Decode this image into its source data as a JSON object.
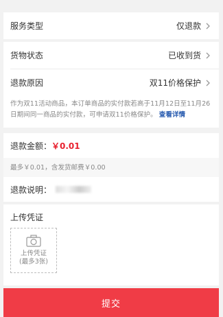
{
  "service": {
    "label": "服务类型",
    "value": "仅退款"
  },
  "goods": {
    "label": "货物状态",
    "value": "已收到货"
  },
  "reason": {
    "label": "退款原因",
    "value": "双11价格保护"
  },
  "note": {
    "text": "作为双11活动商品，本订单商品的实付款若高于11月12日至11月26日期间同一商品的实付款，可申请双11价格保护。",
    "link": "查看详情"
  },
  "refund": {
    "label": "退款金额：",
    "amount": "￥0.01",
    "hint": "最多￥0.01，含发货邮费￥0.00"
  },
  "explain": {
    "label": "退款说明："
  },
  "upload": {
    "title": "上传凭证",
    "box_line1": "上传凭证",
    "box_line2": "(最多3张)"
  },
  "submit": {
    "label": "提交"
  }
}
